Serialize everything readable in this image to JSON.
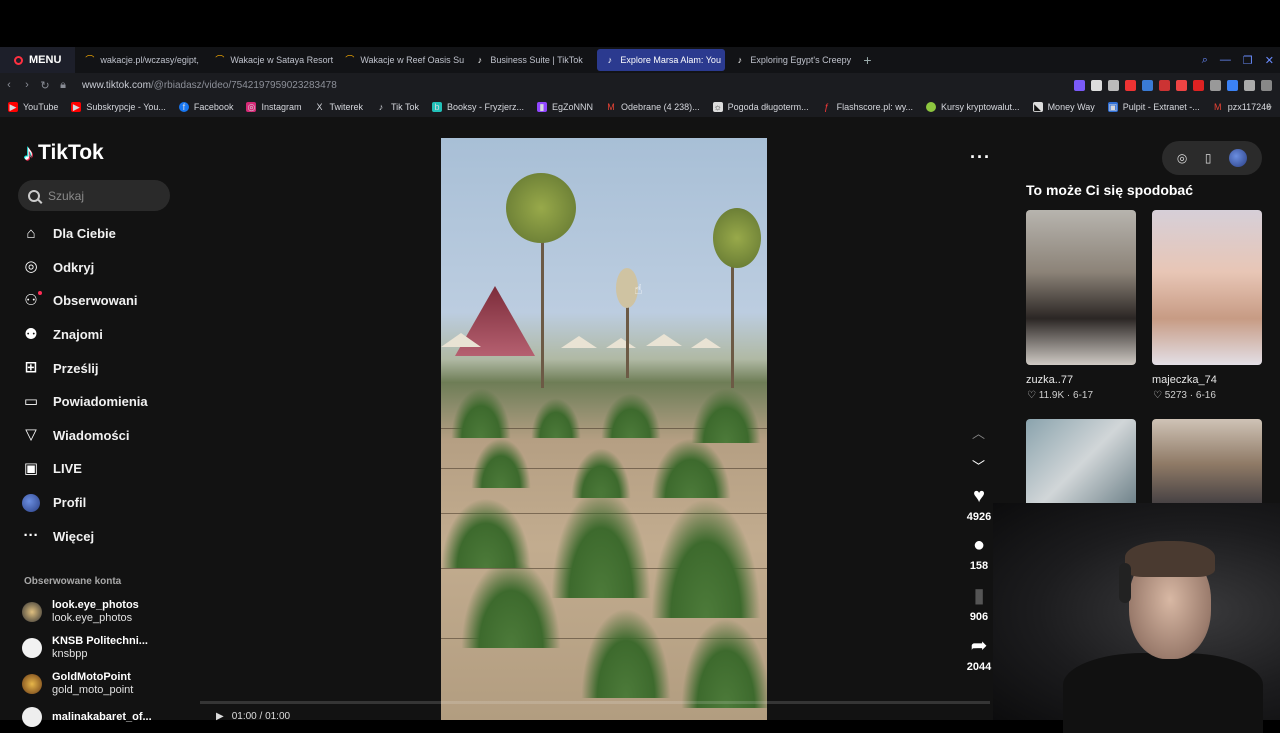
{
  "browser": {
    "menu_label": "MENU",
    "tabs": [
      {
        "title": "wakacje.pl/wczasy/egipt,",
        "active": false
      },
      {
        "title": "Wakacje w Sataya Resort",
        "active": false
      },
      {
        "title": "Wakacje w Reef Oasis Su",
        "active": false
      },
      {
        "title": "Business Suite | TikTok",
        "active": false
      },
      {
        "title": "Explore Marsa Alam: You",
        "active": true
      },
      {
        "title": "Exploring Egypt's Creepy",
        "active": false
      }
    ],
    "url_host": "www.tiktok.com",
    "url_path": "/@rbiadasz/video/7542197959023283478",
    "bookmarks": [
      {
        "label": "YouTube",
        "icon": "youtube-icon",
        "color": "#ff0000"
      },
      {
        "label": "Subskrypcje - You...",
        "icon": "youtube-icon",
        "color": "#ff0000"
      },
      {
        "label": "Facebook",
        "icon": "facebook-icon",
        "color": "#1877f2"
      },
      {
        "label": "Instagram",
        "icon": "instagram-icon",
        "color": "#d62976"
      },
      {
        "label": "Twiterek",
        "icon": "x-icon",
        "color": "#ffffff"
      },
      {
        "label": "Tik Tok",
        "icon": "tiktok-icon",
        "color": "#ffffff"
      },
      {
        "label": "Booksy - Fryzjerz...",
        "icon": "booksy-icon",
        "color": "#22c1b9"
      },
      {
        "label": "EgZoNNN",
        "icon": "twitch-icon",
        "color": "#9146ff"
      },
      {
        "label": "Odebrane (4 238)...",
        "icon": "gmail-icon",
        "color": "#ea4335"
      },
      {
        "label": "Pogoda długoterm...",
        "icon": "weather-icon",
        "color": "#dddddd"
      },
      {
        "label": "Flashscore.pl: wy...",
        "icon": "flashscore-icon",
        "color": "#ff3a3a"
      },
      {
        "label": "Kursy kryptowalut...",
        "icon": "crypto-icon",
        "color": "#8dc63f"
      },
      {
        "label": "Money Way",
        "icon": "moneyway-icon",
        "color": "#dddddd"
      },
      {
        "label": "Pulpit - Extranet -...",
        "icon": "extranet-icon",
        "color": "#2f6fd6"
      },
      {
        "label": "pzx117246",
        "icon": "gmail-icon",
        "color": "#ea4335"
      }
    ]
  },
  "tiktok": {
    "logo_text": "TikTok",
    "search_placeholder": "Szukaj",
    "nav": [
      {
        "label": "Dla Ciebie",
        "icon": "home-icon"
      },
      {
        "label": "Odkryj",
        "icon": "compass-icon"
      },
      {
        "label": "Obserwowani",
        "icon": "following-icon"
      },
      {
        "label": "Znajomi",
        "icon": "friends-icon"
      },
      {
        "label": "Prześlij",
        "icon": "upload-icon"
      },
      {
        "label": "Powiadomienia",
        "icon": "notifications-icon"
      },
      {
        "label": "Wiadomości",
        "icon": "messages-icon"
      },
      {
        "label": "LIVE",
        "icon": "live-icon"
      },
      {
        "label": "Profil",
        "icon": "profile-avatar"
      },
      {
        "label": "Więcej",
        "icon": "more-icon"
      }
    ],
    "followed_title": "Obserwowane konta",
    "followed_accounts": [
      {
        "name": "look.eye_photos",
        "handle": "look.eye_photos"
      },
      {
        "name": "KNSB Politechni...",
        "handle": "knsbpp"
      },
      {
        "name": "GoldMotoPoint",
        "handle": "gold_moto_point"
      },
      {
        "name": "malinakabaret_of...",
        "handle": ""
      }
    ],
    "actions": {
      "likes": "4926",
      "comments": "158",
      "saves": "906",
      "shares": "2044"
    },
    "playback_time": "01:00 / 01:00",
    "recommend_title": "To może Ci się spodobać",
    "recommendations": [
      {
        "user": "zuzka..77",
        "likes": "11.9K",
        "date": "6-17"
      },
      {
        "user": "majeczka_74",
        "likes": "5273",
        "date": "6-16"
      },
      {
        "user": "",
        "likes": "",
        "date": ""
      },
      {
        "user": "",
        "likes": "",
        "date": ""
      }
    ]
  },
  "colors": {
    "accent_red": "#fe2c55",
    "accent_cyan": "#25f4ee",
    "active_tab": "#2b3a8f"
  }
}
